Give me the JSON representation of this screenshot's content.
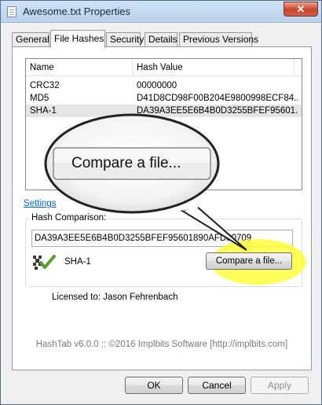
{
  "window": {
    "title": "Awesome.txt Properties",
    "close_glyph": "✕"
  },
  "tabs": [
    {
      "label": "General"
    },
    {
      "label": "File Hashes"
    },
    {
      "label": "Security"
    },
    {
      "label": "Details"
    },
    {
      "label": "Previous Versions"
    }
  ],
  "hash_list": {
    "columns": [
      "Name",
      "Hash Value"
    ],
    "rows": [
      {
        "name": "CRC32",
        "value": "00000000"
      },
      {
        "name": "MD5",
        "value": "D41D8CD98F00B204E9800998ECF84..."
      },
      {
        "name": "SHA-1",
        "value": "DA39A3EE5E6B4B0D3255BFEF95601..."
      }
    ]
  },
  "settings_link": "Settings",
  "hash_comparison": {
    "label": "Hash Comparison:",
    "input_value": "DA39A3EE5E6B4B0D3255BFEF95601890AFD80709",
    "algorithm": "SHA-1",
    "compare_button": "Compare a file...",
    "match_icon": "match-check-icon"
  },
  "magnifier_text": "Compare a file...",
  "license": "Licensed to: Jason Fehrenbach",
  "about": "HashTab v6.0.0 :: ©2016 Implbits Software [http://implbits.com]",
  "buttons": {
    "ok": "OK",
    "cancel": "Cancel",
    "apply": "Apply"
  },
  "colors": {
    "highlight": "#ffff28",
    "link": "#0066cc"
  }
}
